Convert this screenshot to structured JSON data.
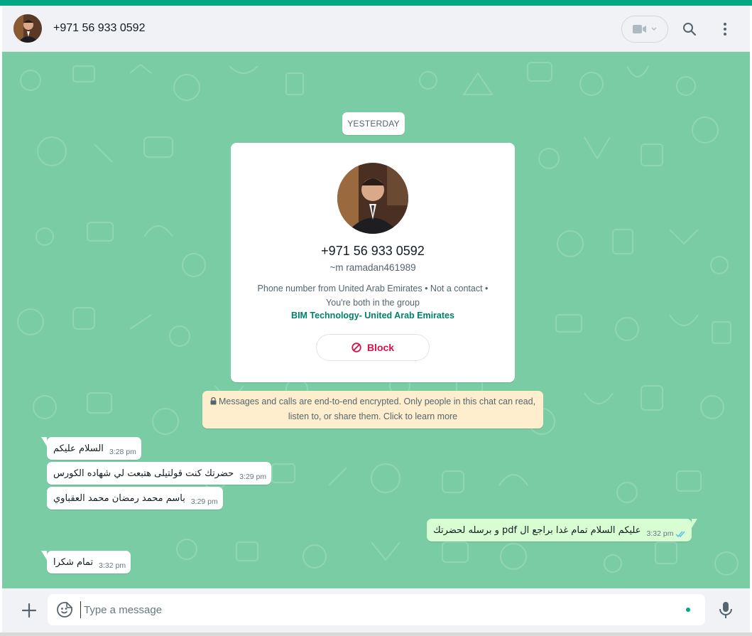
{
  "header": {
    "contact_phone": "+971 56 933 0592"
  },
  "chat": {
    "date_chip": "YESTERDAY",
    "contact_card": {
      "phone": "+971 56 933 0592",
      "name": "~m ramadan461989",
      "info_line1": "Phone number from United Arab Emirates • Not a contact •",
      "info_line2": "You're both in the group",
      "group_name": "BIM Technology- United Arab Emirates",
      "block_label": "Block"
    },
    "encryption_notice": {
      "line1": "Messages and calls are end-to-end encrypted. Only people in this chat can read,",
      "line2": "listen to, or share them. Click to learn more"
    },
    "messages": [
      {
        "direction": "in",
        "text": "السلام عليكم",
        "time": "3:28 pm"
      },
      {
        "direction": "in",
        "text": "حضرتك كنت قولتيلى هتبعت لي شهاده الكورس",
        "time": "3:29 pm"
      },
      {
        "direction": "in",
        "text": "باسم محمد رمضان محمد العقباوي",
        "time": "3:29 pm"
      },
      {
        "direction": "out",
        "text": "عليكم السلام تمام غدا براجع ال pdf و برسله لحضرتك",
        "time": "3:32 pm",
        "status": "read"
      },
      {
        "direction": "in",
        "text": "تمام شكرا",
        "time": "3:32 pm"
      }
    ]
  },
  "composer": {
    "placeholder": "Type a message"
  },
  "icons": [
    "video-call-icon",
    "chevron-down-icon",
    "search-icon",
    "menu-dots-icon",
    "block-icon",
    "lock-icon",
    "plus-icon",
    "emoji-icon",
    "mic-icon",
    "double-check-icon"
  ],
  "colors": {
    "accent": "#00a884",
    "chat_background": "#7acca4",
    "outgoing_bubble": "#d9fdd3",
    "block_red": "#d4134b",
    "group_link": "#008069",
    "notice_bg": "#ffeecd"
  }
}
